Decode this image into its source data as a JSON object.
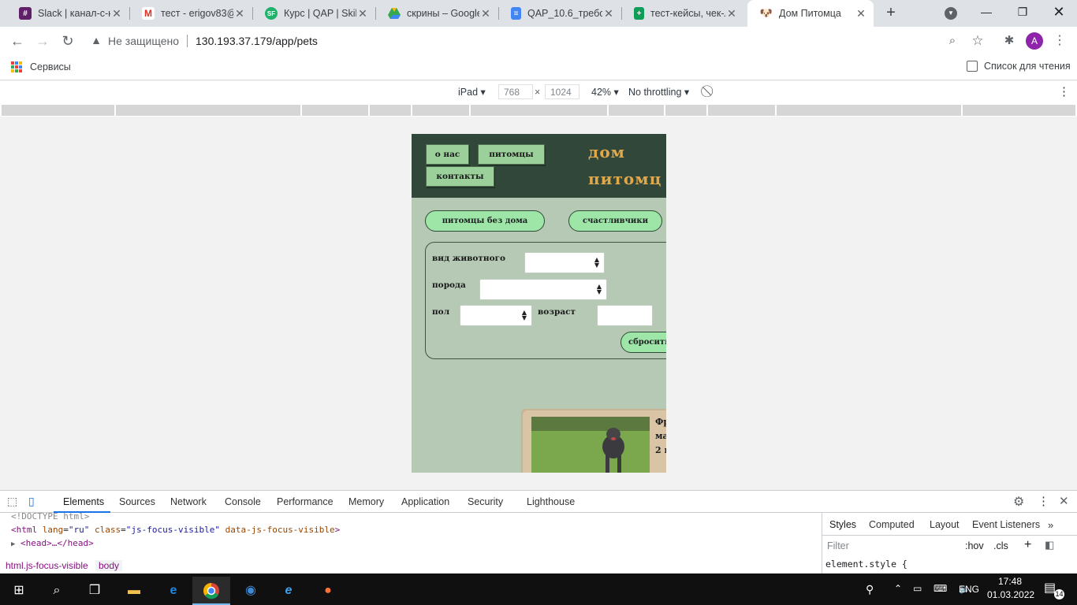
{
  "browser": {
    "tabs": [
      {
        "title": "Slack | канал-с-на",
        "favicon": "slack-icon",
        "color": "#4a154b"
      },
      {
        "title": "тест - erigov83@",
        "favicon": "gmail-icon",
        "color": "#d93025"
      },
      {
        "title": "Курс | QAP | Skillf",
        "favicon": "skillfactory-icon",
        "color": "#20b26b"
      },
      {
        "title": "скрины – Google",
        "favicon": "google-drive-icon",
        "color": "#fbbc04"
      },
      {
        "title": "QAP_10.6_требов",
        "favicon": "google-docs-icon",
        "color": "#4285f4"
      },
      {
        "title": "тест-кейсы, чек-л",
        "favicon": "google-sheets-icon",
        "color": "#0f9d58"
      },
      {
        "title": "Дом Питомца",
        "favicon": "dog-icon",
        "color": "#202124",
        "active": true
      }
    ],
    "address": {
      "security_label": "Не защищено",
      "url": "130.193.37.179/app/pets"
    },
    "profile_initial": "A",
    "bookmarks": {
      "apps_label": "Сервисы",
      "reading_list_label": "Список для чтения"
    }
  },
  "device_toolbar": {
    "device": "iPad",
    "width": "768",
    "times": "×",
    "height": "1024",
    "zoom": "42%",
    "throttling": "No throttling"
  },
  "site": {
    "nav": {
      "about": "о нас",
      "pets": "питомцы",
      "contacts": "контакты"
    },
    "title_line1": "дом",
    "title_line2": "питомц",
    "buttons": {
      "homeless": "питомцы без дома",
      "lucky": "счастливчики"
    },
    "filters": {
      "species_label": "вид животного",
      "breed_label": "порода",
      "sex_label": "пол",
      "age_label": "возраст",
      "reset_label": "сбросить"
    },
    "card": {
      "line1": "Фр",
      "line2": "ма",
      "line3": "2 г"
    }
  },
  "devtools": {
    "tabs": [
      "Elements",
      "Sources",
      "Network",
      "Console",
      "Performance",
      "Memory",
      "Application",
      "Security",
      "Lighthouse"
    ],
    "code": {
      "doctype": "<!DOCTYPE html>",
      "html_tag_open": "<html",
      "html_attr1": "lang",
      "html_val1": "\"ru\"",
      "html_attr2": "class",
      "html_val2": "\"js-focus-visible\"",
      "html_attr3": "data-js-focus-visible",
      "html_tag_close": ">",
      "head": "<head>…</head>"
    },
    "styles_tabs": [
      "Styles",
      "Computed",
      "Layout",
      "Event Listeners"
    ],
    "filter_placeholder": "Filter",
    "hov": ":hov",
    "cls": ".cls",
    "element_style": "element.style {",
    "breadcrumbs": [
      "html.js-focus-visible",
      "body"
    ]
  },
  "taskbar": {
    "language": "ENG",
    "time": "17:48",
    "date": "01.03.2022",
    "notifications": "14"
  }
}
